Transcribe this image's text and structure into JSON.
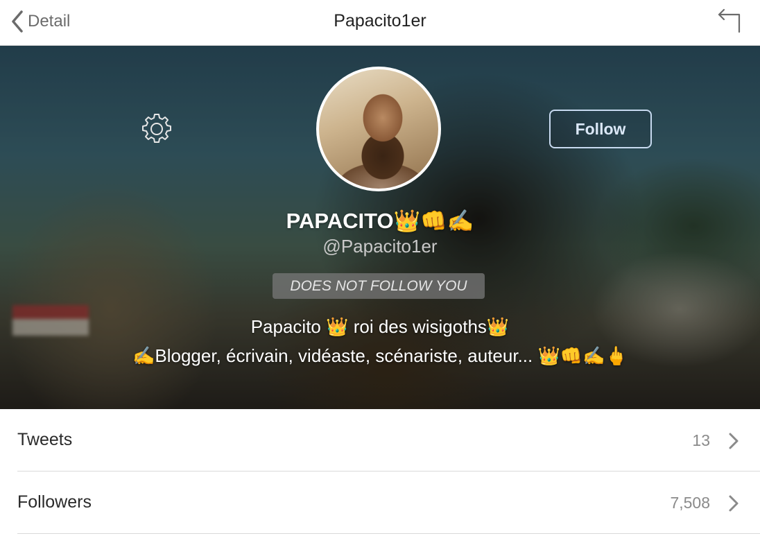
{
  "nav": {
    "back_label": "Detail",
    "title": "Papacito1er"
  },
  "profile": {
    "display_name": "PAPACITO👑👊✍️",
    "handle": "@Papacito1er",
    "follow_button": "Follow",
    "follow_status": "DOES NOT FOLLOW YOU",
    "bio_line1": "Papacito 👑 roi des wisigoths👑",
    "bio_line2": "✍️Blogger, écrivain, vidéaste, scénariste, auteur... 👑👊✍️🖕"
  },
  "stats": [
    {
      "label": "Tweets",
      "count": "13"
    },
    {
      "label": "Followers",
      "count": "7,508"
    }
  ],
  "icons": {
    "back": "chevron-left-icon",
    "reply": "reply-arrow-icon",
    "settings": "gear-icon",
    "row_disclosure": "chevron-right-icon"
  },
  "colors": {
    "nav_text": "#222222",
    "follow_border": "#c8daf0",
    "secondary_text": "#8a8a8a"
  }
}
